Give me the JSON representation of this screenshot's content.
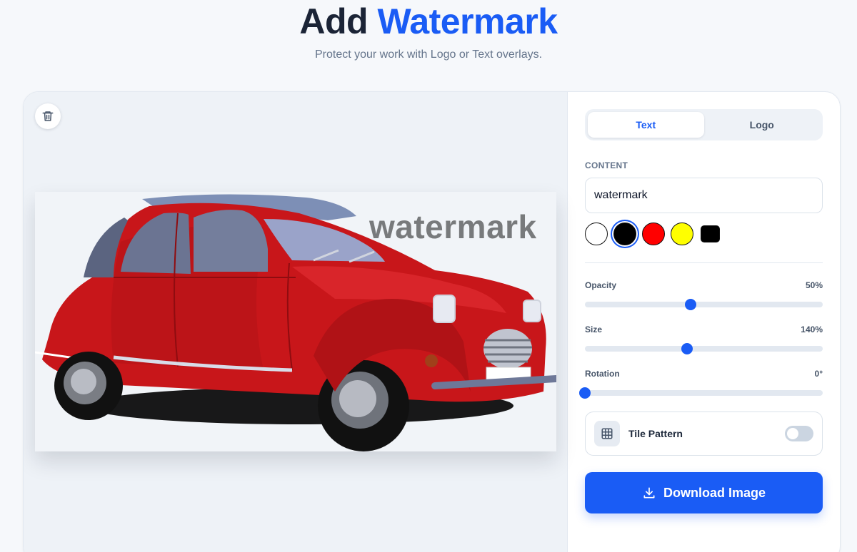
{
  "header": {
    "title_main": "Add",
    "title_accent": "Watermark",
    "subtitle": "Protect your work with Logo or Text overlays."
  },
  "preview": {
    "watermark_text": "watermark",
    "icons": {
      "delete": "trash-icon"
    }
  },
  "panel": {
    "tabs": [
      {
        "label": "Text",
        "active": true
      },
      {
        "label": "Logo",
        "active": false
      }
    ],
    "content_label": "CONTENT",
    "content_value": "watermark",
    "colors": [
      {
        "name": "white",
        "hex": "#ffffff",
        "selected": false
      },
      {
        "name": "black",
        "hex": "#000000",
        "selected": true
      },
      {
        "name": "red",
        "hex": "#ff0000",
        "selected": false
      },
      {
        "name": "yellow",
        "hex": "#ffff00",
        "selected": false
      },
      {
        "name": "black-square",
        "hex": "#000000",
        "selected": false
      }
    ],
    "opacity": {
      "label": "Opacity",
      "value_text": "50%",
      "fraction": 0.445
    },
    "size": {
      "label": "Size",
      "value_text": "140%",
      "fraction": 0.43
    },
    "rotation": {
      "label": "Rotation",
      "value_text": "0°",
      "fraction": 0.0
    },
    "tile": {
      "label": "Tile Pattern",
      "enabled": false,
      "icon": "grid-icon"
    },
    "download": {
      "label": "Download Image",
      "icon": "download-icon"
    }
  },
  "colors": {
    "accent": "#1a5cf5",
    "title": "#1b2436"
  }
}
